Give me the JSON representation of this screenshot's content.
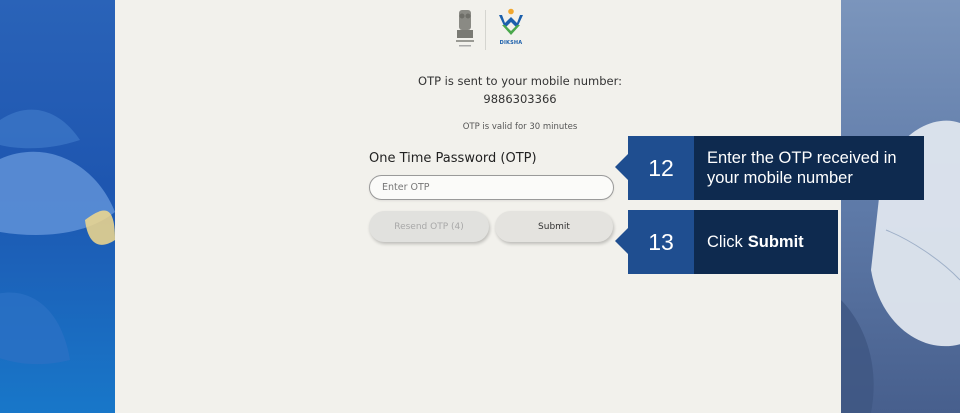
{
  "header": {
    "brand_name": "DIKSHA"
  },
  "otp_info": {
    "sent_message": "OTP is sent to your mobile number:",
    "mobile_number": "9886303366",
    "validity": "OTP is valid for 30 minutes"
  },
  "form": {
    "label": "One Time Password (OTP)",
    "placeholder": "Enter OTP",
    "resend_label": "Resend OTP (4)",
    "submit_label": "Submit"
  },
  "callouts": [
    {
      "number": "12",
      "text": "Enter the OTP received in your mobile number"
    },
    {
      "number": "13",
      "text_prefix": "Click",
      "text_bold": "Submit"
    }
  ],
  "colors": {
    "panel_bg": "#f2f1ec",
    "callout_number_bg": "#1f4e90",
    "callout_text_bg": "#0e2a4f",
    "diksha_blue": "#1b5fab",
    "diksha_green": "#4aa84c",
    "diksha_orange": "#f2a72e"
  }
}
